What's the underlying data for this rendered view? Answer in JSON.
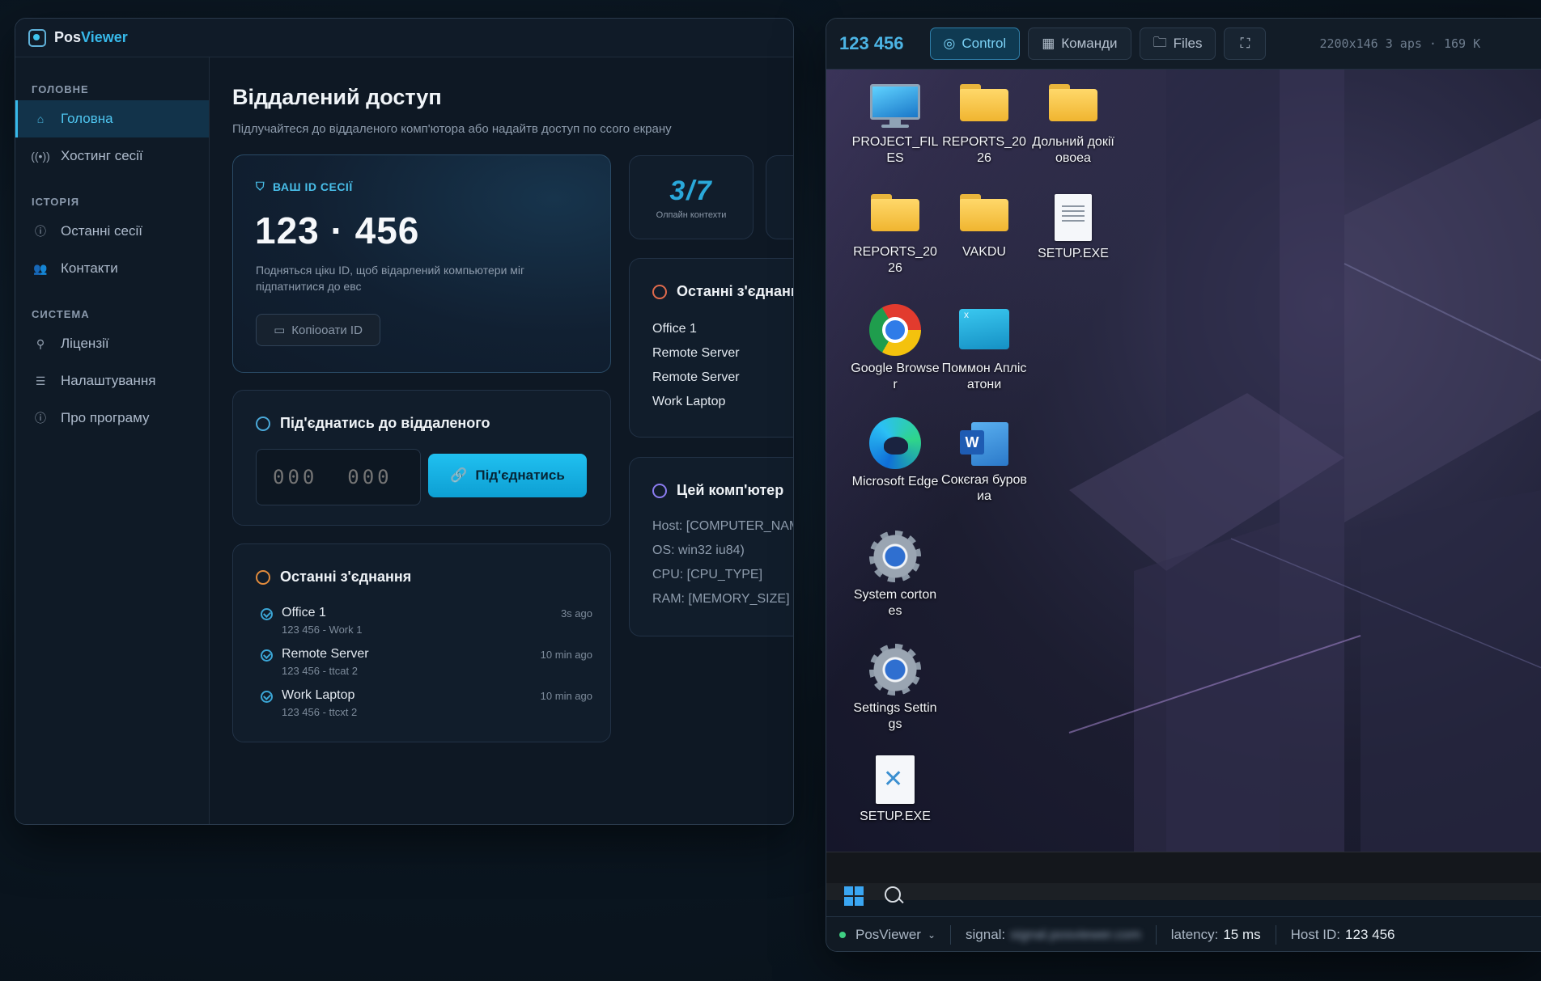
{
  "app": {
    "name_part1": "Pos",
    "name_part2": "Viewer",
    "accent_color": "#37b9ea"
  },
  "sidebar": {
    "sections": [
      {
        "title": "ГОЛОВНЕ",
        "items": [
          {
            "label": "Головна",
            "icon": "home-icon",
            "active": true
          },
          {
            "label": "Хостинг сесії",
            "icon": "broadcast-icon",
            "active": false
          }
        ]
      },
      {
        "title": "ІСТОРІЯ",
        "items": [
          {
            "label": "Останні сесії",
            "icon": "info-icon",
            "active": false
          },
          {
            "label": "Контакти",
            "icon": "contacts-icon",
            "active": false
          }
        ]
      },
      {
        "title": "СИСТЕМА",
        "items": [
          {
            "label": "Ліцензії",
            "icon": "license-icon",
            "active": false
          },
          {
            "label": "Налаштування",
            "icon": "sliders-icon",
            "active": false
          },
          {
            "label": "Про програму",
            "icon": "info-icon",
            "active": false
          }
        ]
      }
    ]
  },
  "main": {
    "title": "Віддалений доступ",
    "subtitle": "Підлучайтеся до віддаленого комп'ютора або надайтв доступ по ссого екрану",
    "id_card": {
      "label": "ВАШ ID СЕСІЇ",
      "value": "123 · 456",
      "description": "Подняться цікu ID, щоб відарлений компьютери міг підпатнитися до евс",
      "copy_button": "Копіооати ID"
    },
    "connect": {
      "title": "Під'єднатись до віддаленого",
      "placeholder": "000  000",
      "button": "Під'єднатись"
    },
    "recent": {
      "title": "Останні з'єднання",
      "items": [
        {
          "name": "Office 1",
          "sub": "123 456 - Work 1",
          "time": "3s ago"
        },
        {
          "name": "Remote Server",
          "sub": "123 456 - ttcat 2",
          "time": "10 min ago"
        },
        {
          "name": "Work Laptop",
          "sub": "123 456 - ttcxt 2",
          "time": "10 min ago"
        }
      ]
    },
    "stat": {
      "value": "3/7",
      "label": "Олпайн контехти"
    },
    "recent2": {
      "title": "Останні з'єднання",
      "items": [
        "Office 1",
        "Remote Server",
        "Remote Server",
        "Work Laptop"
      ]
    },
    "this_pc": {
      "title": "Цей комп'ютер",
      "items": [
        "Host: [COMPUTER_NAME]",
        "OS: win32 iu84)",
        "CPU: [CPU_TYPE]",
        "RAM: [MEMORY_SIZE]"
      ]
    }
  },
  "remote": {
    "id": "123 456",
    "tabs": [
      {
        "label": "Control",
        "icon": "mouse-icon",
        "active": true
      },
      {
        "label": "Команди",
        "icon": "keyboard-icon",
        "active": false
      },
      {
        "label": "Files",
        "icon": "folder-icon",
        "active": false
      }
    ],
    "fullscreen_icon": "fullscreen-icon",
    "info": "2200x146 3 aps · 169 K",
    "desktop_icons": [
      {
        "label": "PROJECT_FILES",
        "type": "monitor"
      },
      {
        "label": "REPORTS_2026",
        "type": "folder"
      },
      {
        "label": "Дольний докіїовоеа",
        "type": "folder"
      },
      {
        "label": "REPORTS_2026",
        "type": "folder"
      },
      {
        "label": "VAKDU",
        "type": "folder"
      },
      {
        "label": "SETUP.EXE",
        "type": "document"
      },
      {
        "label": "Google Browser",
        "type": "chrome"
      },
      {
        "label": "Поммон Аплісатони",
        "type": "app-window"
      },
      {
        "label": "Microsoft Edge",
        "type": "edge"
      },
      {
        "label": "Сокєrая буровиа",
        "type": "word"
      },
      {
        "label": "System cortones",
        "type": "gear"
      },
      {
        "label": "Settings Settings",
        "type": "gear"
      },
      {
        "label": "SETUP.EXE",
        "type": "tool"
      }
    ],
    "status": {
      "app": "PosViewer",
      "signal_label": "signal:",
      "signal_value": "signal.posviewer.com",
      "latency_label": "latency:",
      "latency_value": "15 ms",
      "host_label": "Host ID:",
      "host_value": "123 456"
    }
  }
}
